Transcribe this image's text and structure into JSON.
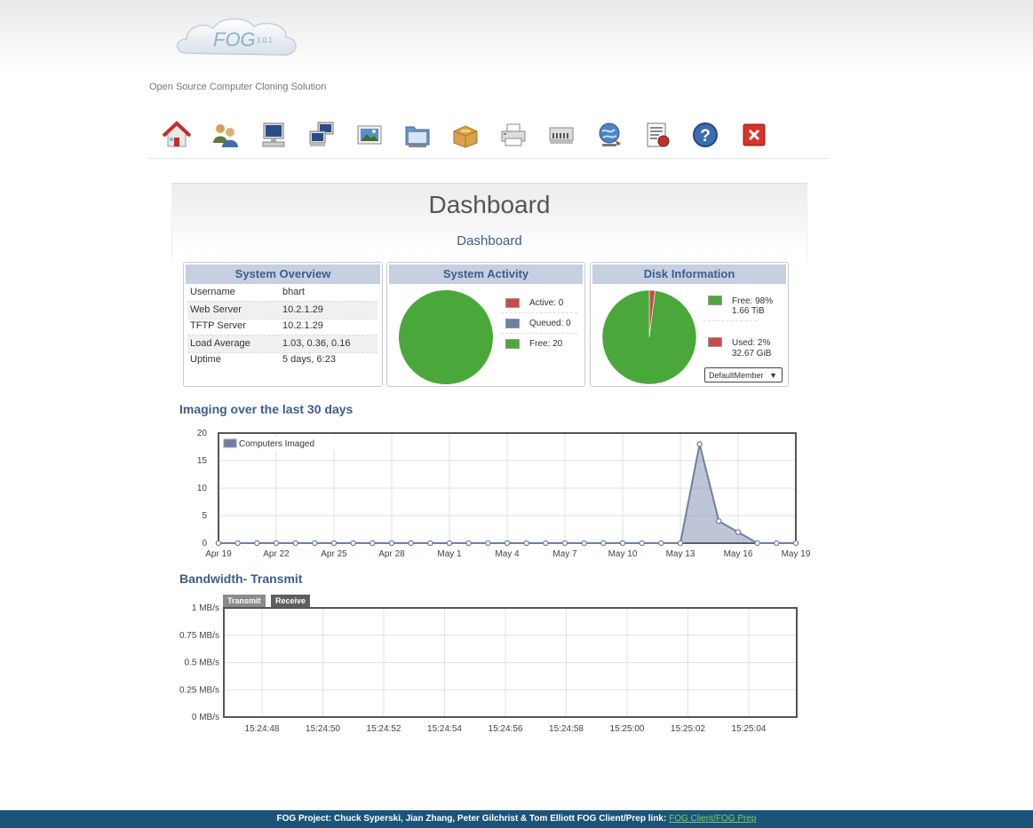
{
  "header": {
    "logo_text": "FOG",
    "version": "1.0.1",
    "tagline": "Open Source Computer Cloning Solution"
  },
  "nav": [
    {
      "icon": "home-icon"
    },
    {
      "icon": "users-icon"
    },
    {
      "icon": "host-computer-icon"
    },
    {
      "icon": "groups-icon"
    },
    {
      "icon": "images-icon"
    },
    {
      "icon": "storage-icon"
    },
    {
      "icon": "snapins-icon"
    },
    {
      "icon": "printer-icon"
    },
    {
      "icon": "service-icon"
    },
    {
      "icon": "tasks-icon"
    },
    {
      "icon": "reports-icon"
    },
    {
      "icon": "help-icon"
    },
    {
      "icon": "logout-icon"
    }
  ],
  "dashboard": {
    "title": "Dashboard",
    "subtitle": "Dashboard"
  },
  "overview": {
    "title": "System Overview",
    "rows": [
      {
        "label": "Username",
        "value": "bhart"
      },
      {
        "label": "Web Server",
        "value": "10.2.1.29"
      },
      {
        "label": "TFTP Server",
        "value": "10.2.1.29"
      },
      {
        "label": "Load Average",
        "value": "1.03, 0.36, 0.16"
      },
      {
        "label": "Uptime",
        "value": "5 days, 6:23"
      }
    ]
  },
  "activity": {
    "title": "System Activity",
    "legend": [
      {
        "label": "Active: 0",
        "color": "#cb4b4b",
        "value": 0
      },
      {
        "label": "Queued: 0",
        "color": "#6e7fa6",
        "value": 0
      },
      {
        "label": "Free: 20",
        "color": "#4aa83a",
        "value": 20
      }
    ]
  },
  "disk": {
    "title": "Disk Information",
    "free": {
      "label": "Free: 98%",
      "size": "1.66 TiB",
      "color": "#4aa83a",
      "percent": 98
    },
    "used": {
      "label": "Used: 2%",
      "size": "32.67 GiB",
      "color": "#cb4b4b",
      "percent": 2
    },
    "select_value": "DefaultMember"
  },
  "imaging_section": {
    "title": "Imaging over the last 30 days"
  },
  "bandwidth_section": {
    "title": "Bandwidth- Transmit",
    "tabs": [
      {
        "label": "Transmit"
      },
      {
        "label": "Receive"
      }
    ]
  },
  "chart_data": [
    {
      "type": "area",
      "title": "Imaging over the last 30 days",
      "series": [
        {
          "name": "Computers Imaged",
          "color": "#6e7fa6",
          "values": [
            0,
            0,
            0,
            0,
            0,
            0,
            0,
            0,
            0,
            0,
            0,
            0,
            0,
            0,
            0,
            0,
            0,
            0,
            0,
            0,
            0,
            0,
            0,
            0,
            0,
            18,
            4,
            2,
            0,
            0,
            0
          ]
        }
      ],
      "x_tick_labels": [
        "Apr 19",
        "Apr 22",
        "Apr 25",
        "Apr 28",
        "May 1",
        "May 4",
        "May 7",
        "May 10",
        "May 13",
        "May 16",
        "May 19"
      ],
      "y_ticks": [
        0,
        5,
        10,
        15,
        20
      ],
      "ylim": [
        0,
        20
      ],
      "legend": "top-left",
      "grid": true
    },
    {
      "type": "line",
      "title": "Bandwidth- Transmit",
      "series": [],
      "x_tick_labels": [
        "15:24:48",
        "15:24:50",
        "15:24:52",
        "15:24:54",
        "15:24:56",
        "15:24:58",
        "15:25:00",
        "15:25:02",
        "15:25:04"
      ],
      "y_tick_labels": [
        "0 MB/s",
        "0.25 MB/s",
        "0.5 MB/s",
        "0.75 MB/s",
        "1 MB/s"
      ],
      "ylim": [
        0,
        1
      ],
      "grid": true
    }
  ],
  "footer": {
    "text": "FOG Project: Chuck Syperski, Jian Zhang, Peter Gilchrist & Tom Elliott FOG Client/Prep link: ",
    "link_text": "FOG Client/FOG Prep"
  }
}
